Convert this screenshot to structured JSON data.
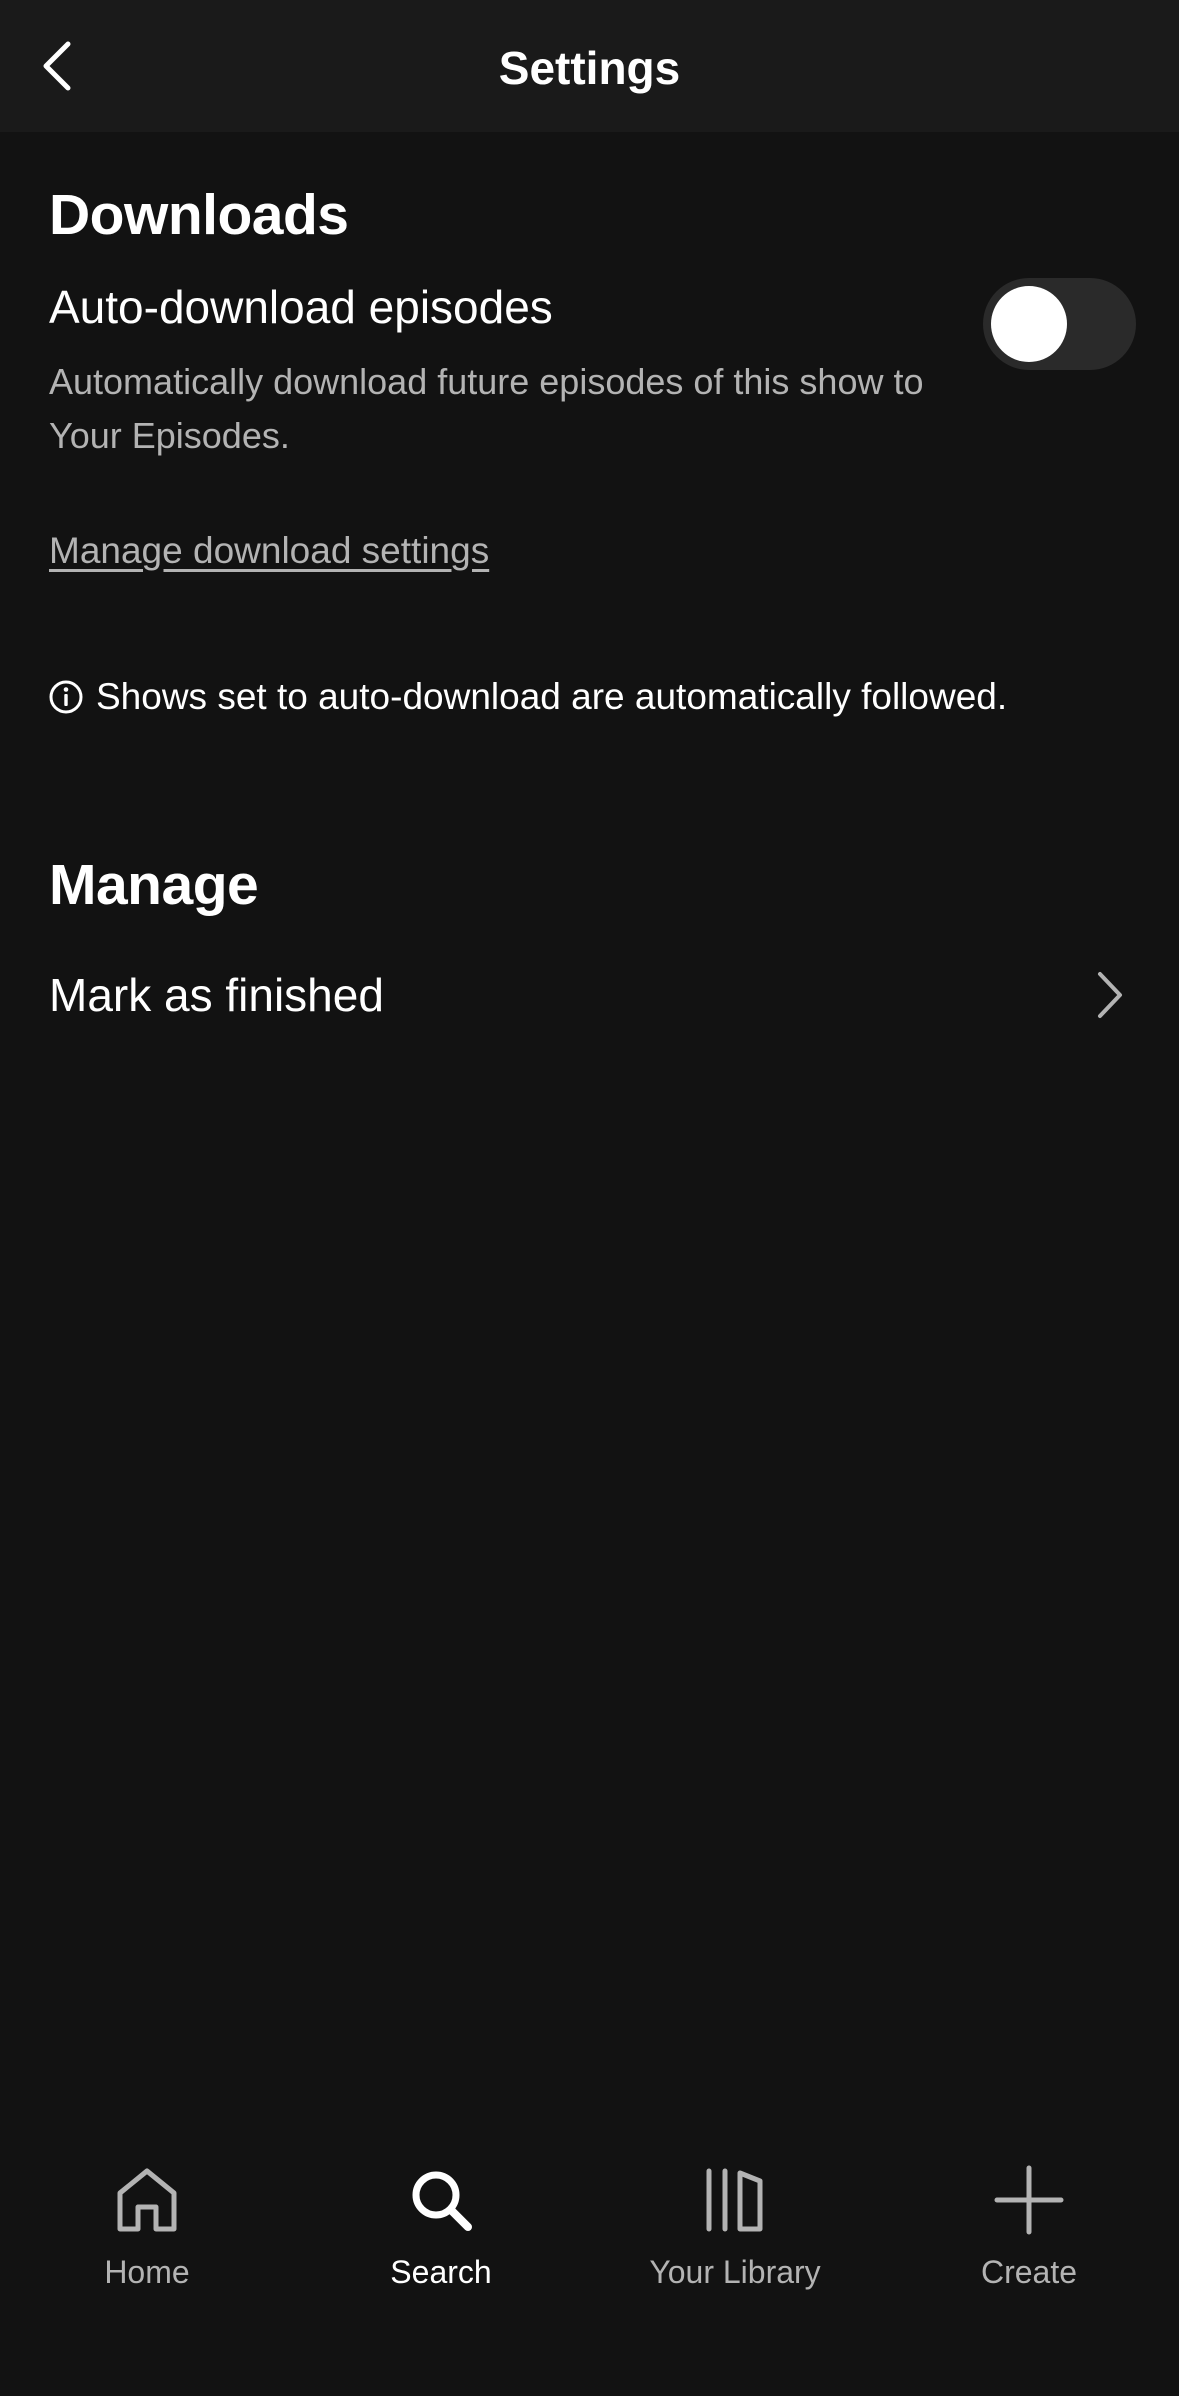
{
  "header": {
    "title": "Settings",
    "back_icon": "chevron-left-icon"
  },
  "downloads": {
    "heading": "Downloads",
    "auto_download": {
      "title": "Auto-download episodes",
      "description": "Automatically download future episodes of this show to Your Episodes.",
      "enabled": false
    },
    "manage_link": "Manage download settings",
    "info_icon": "info-circle-icon",
    "info_note": "Shows set to auto-download are automatically followed."
  },
  "manage": {
    "heading": "Manage",
    "items": [
      {
        "label": "Mark as finished",
        "icon": "chevron-right-icon"
      }
    ]
  },
  "bottom_nav": {
    "active": "search",
    "items": [
      {
        "id": "home",
        "label": "Home",
        "icon": "home-icon"
      },
      {
        "id": "search",
        "label": "Search",
        "icon": "search-icon"
      },
      {
        "id": "library",
        "label": "Your Library",
        "icon": "library-icon"
      },
      {
        "id": "create",
        "label": "Create",
        "icon": "plus-icon"
      }
    ]
  },
  "colors": {
    "background": "#121212",
    "header_background": "#1a1a1a",
    "text_primary": "#ffffff",
    "text_secondary": "#b3b3b3",
    "toggle_track": "#2a2a2a"
  }
}
